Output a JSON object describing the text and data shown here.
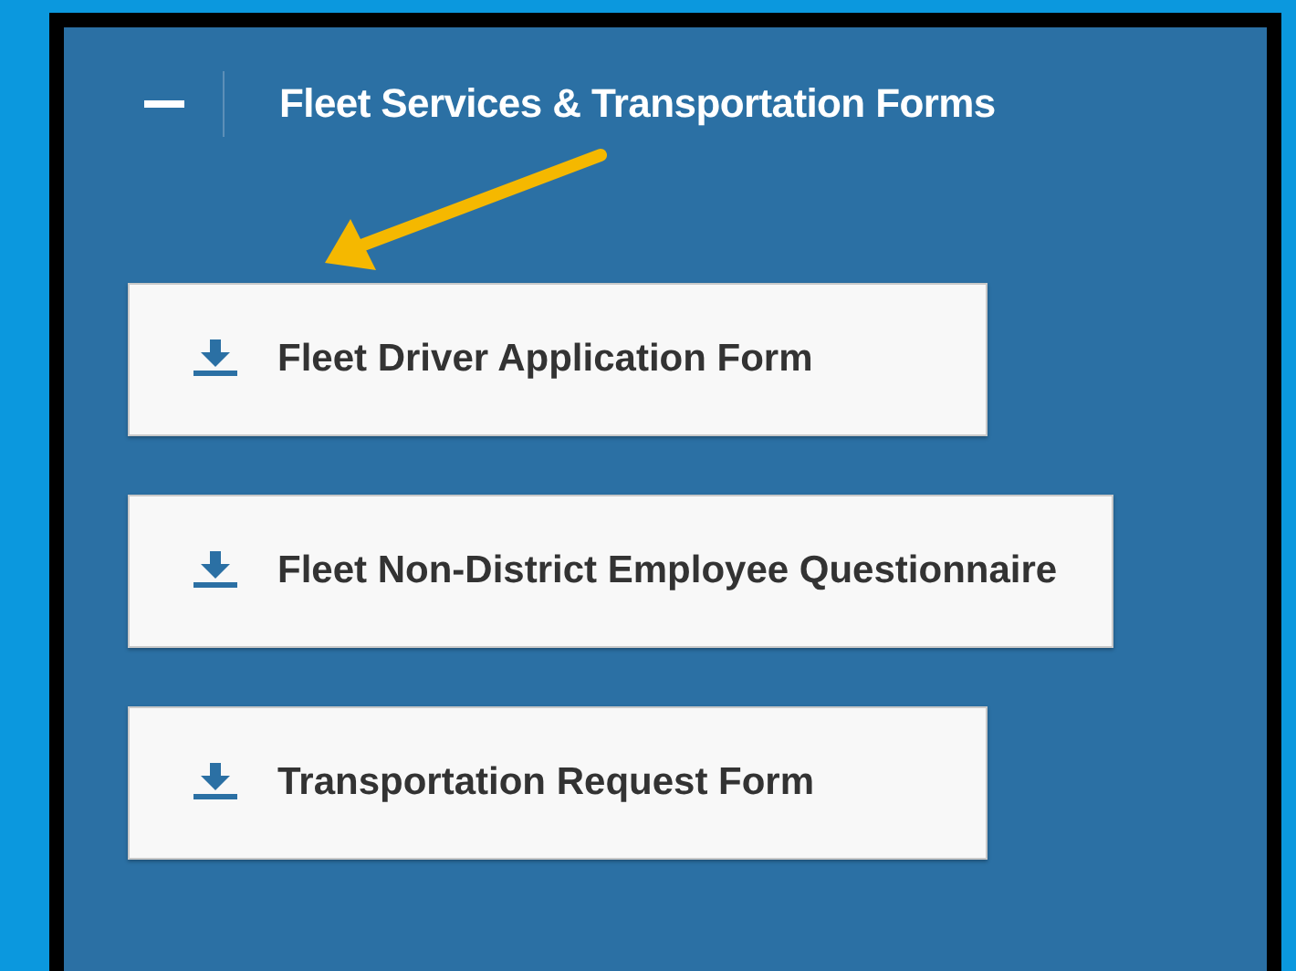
{
  "section": {
    "title": "Fleet Services & Transportation Forms",
    "expanded": true
  },
  "forms": [
    {
      "label": "Fleet Driver Application Form"
    },
    {
      "label": "Fleet Non-District Employee Questionnaire"
    },
    {
      "label": "Transportation Request Form"
    }
  ]
}
